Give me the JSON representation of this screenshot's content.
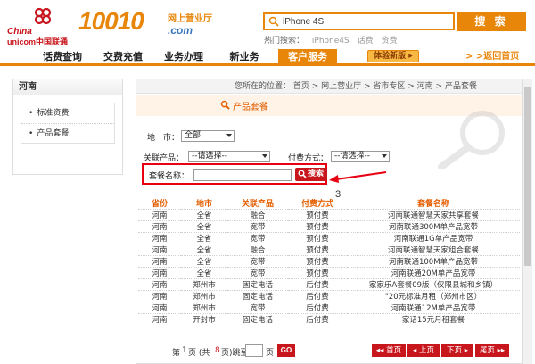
{
  "header": {
    "logo_china": "China",
    "logo_unicom": "unicom中国联通",
    "logo_number": "10010",
    "logo_domain": ".com",
    "logo_slogan": "网上营业厅",
    "search_value": "iPhone 4S",
    "search_button": "搜 索",
    "hot_label": "热门搜索：",
    "hot_keywords": [
      "iPhone4S",
      "话费",
      "资费"
    ]
  },
  "nav": {
    "items": [
      "话费查询",
      "交费充值",
      "业务办理",
      "新业务",
      "客户服务"
    ],
    "active_index": 4,
    "trial_label": "体验新版",
    "back_label": "> >返回首页"
  },
  "sidebar": {
    "title": "河南",
    "items": [
      "标准资费",
      "产品套餐"
    ]
  },
  "breadcrumb": "您所在的位置： 首页 > 网上营业厅 > 省市专区 > 河南 > 产品套餐",
  "section_title": "产品套餐",
  "filters": {
    "city_label": "地　市：",
    "city_value": "全部",
    "product_label": "关联产品：",
    "product_value": "--请选择--",
    "pay_label": "付费方式：",
    "pay_value": "--请选择--",
    "name_label": "套餐名称：",
    "search_button": "搜索"
  },
  "annotation_number": "3",
  "table": {
    "headers": [
      "省份",
      "地市",
      "关联产品",
      "付费方式",
      "套餐名称"
    ],
    "rows": [
      [
        "河南",
        "全省",
        "融合",
        "预付费",
        "河南联通智慧天家共享套餐"
      ],
      [
        "河南",
        "全省",
        "宽带",
        "预付费",
        "河南联通300M单产品宽带"
      ],
      [
        "河南",
        "全省",
        "宽带",
        "预付费",
        "河南联通1G单产品宽带"
      ],
      [
        "河南",
        "全省",
        "融合",
        "预付费",
        "河南联通智慧天家组合套餐"
      ],
      [
        "河南",
        "全省",
        "宽带",
        "预付费",
        "河南联通100M单产品宽带"
      ],
      [
        "河南",
        "全省",
        "宽带",
        "预付费",
        "河南联通20M单产品宽带"
      ],
      [
        "河南",
        "郑州市",
        "固定电话",
        "后付费",
        "家家乐A套餐09版（仅限县城和乡镇）"
      ],
      [
        "河南",
        "郑州市",
        "固定电话",
        "后付费",
        "\"20元标准月租（郑州市区）"
      ],
      [
        "河南",
        "郑州市",
        "宽带",
        "后付费",
        "河南联通12M单产品宽带"
      ],
      [
        "河南",
        "开封市",
        "固定电话",
        "后付费",
        "家话15元月租套餐"
      ]
    ]
  },
  "pager": {
    "prefix": "第",
    "current": "1",
    "middle": "页 (共",
    "total": "8",
    "suffix": "页)跳至",
    "page_word": "页",
    "go": "GO",
    "first": "首页",
    "prev": "上页",
    "next": "下页",
    "last": "尾页"
  },
  "colors": {
    "brand_orange": "#e8860a",
    "unicom_red": "#c8161d",
    "highlight_red": "#e60012",
    "title_orange": "#e35d00"
  }
}
